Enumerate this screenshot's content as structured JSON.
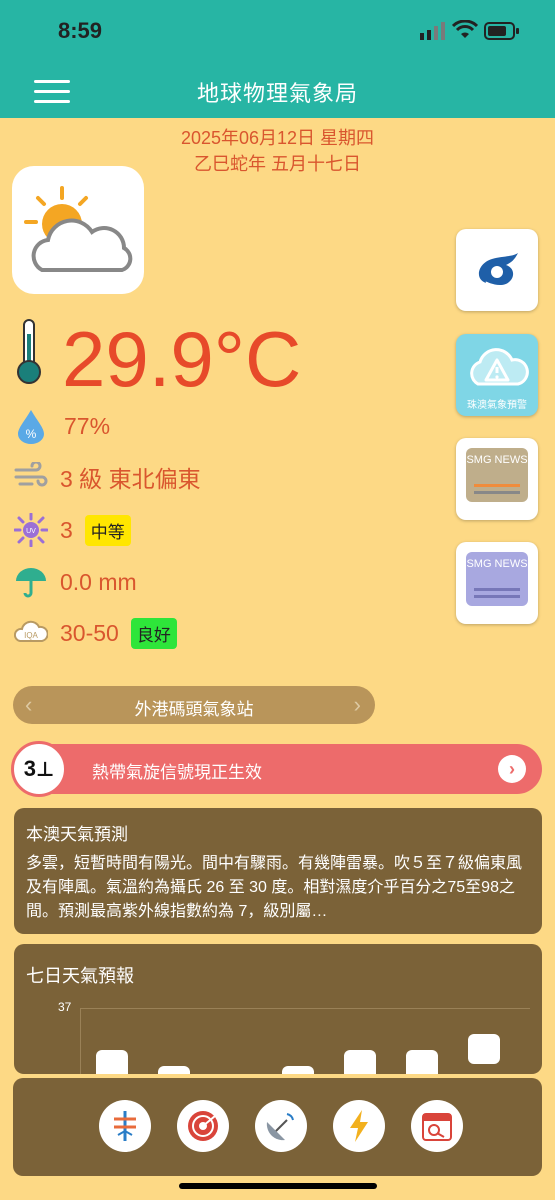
{
  "status": {
    "time": "8:59"
  },
  "header": {
    "title": "地球物理氣象局"
  },
  "date": {
    "gregorian": "2025年06月12日 星期四",
    "lunar": "乙巳蛇年 五月十七日"
  },
  "current": {
    "temperature": "29.9°C",
    "humidity": "77%",
    "wind": "3 級 東北偏東",
    "uv_index": "3",
    "uv_level": "中等",
    "rainfall": "0.0 mm",
    "aqi": "30-50",
    "aqi_level": "良好"
  },
  "side_buttons": {
    "warning_label": "珠澳氣象預警",
    "news1": "SMG NEWS",
    "news2": "SMG NEWS"
  },
  "station": {
    "name": "外港碼頭氣象站"
  },
  "alert": {
    "signal": "3",
    "text": "熱帶氣旋信號現正生效"
  },
  "forecast": {
    "title": "本澳天氣預測",
    "body": "多雲，短暫時間有陽光。間中有驟雨。有幾陣雷暴。吹５至７級偏東風及有陣風。氣溫約為攝氏 26 至 30 度。相對濕度介乎百分之75至98之間。預測最高紫外線指數約為 7，級別屬…"
  },
  "weekly": {
    "title": "七日天氣預報",
    "y_max_label": "37"
  },
  "colors": {
    "accent": "#27b5a4",
    "background": "#fdd985",
    "text_red": "#d9562e",
    "card": "#7b6238",
    "alert": "#ed6b6b"
  }
}
